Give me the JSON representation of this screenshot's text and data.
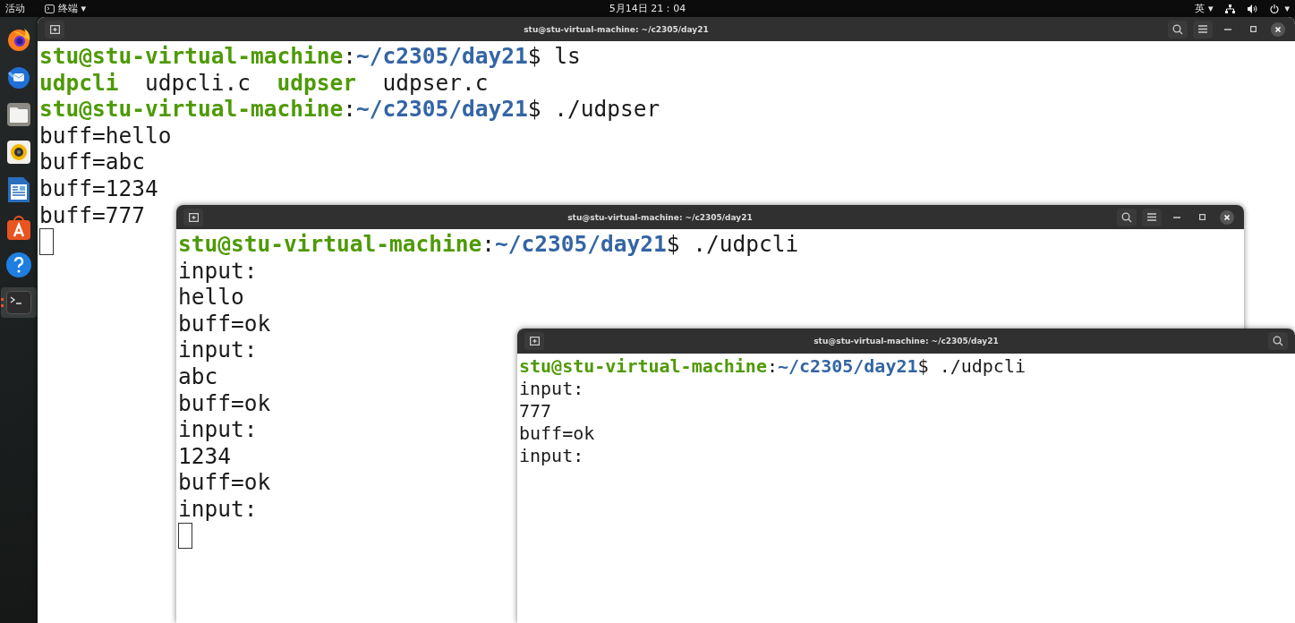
{
  "top_bar": {
    "activities": "活动",
    "app_menu": "终端",
    "app_menu_caret": "▾",
    "clock": "5月14日 21：04",
    "input_method": "英",
    "input_caret": "▾",
    "system_caret": "▾"
  },
  "dock": {
    "items": [
      {
        "kind": "browser",
        "selected": false
      },
      {
        "kind": "mail",
        "selected": false
      },
      {
        "kind": "files",
        "selected": false
      },
      {
        "kind": "music",
        "selected": false
      },
      {
        "kind": "document",
        "selected": false
      },
      {
        "kind": "store",
        "selected": false
      },
      {
        "kind": "help",
        "selected": false
      },
      {
        "kind": "terminal",
        "selected": true
      }
    ]
  },
  "windows": [
    {
      "title": "stu@stu-virtual-machine: ~/c2305/day21",
      "kind": "large",
      "controls": [
        {
          "kind": "search"
        },
        {
          "kind": "menu"
        },
        {
          "kind": "minimize"
        },
        {
          "kind": "maximize"
        },
        {
          "kind": "close"
        }
      ],
      "cursor": true,
      "lines": [
        [
          {
            "kind": "user",
            "text": "stu@stu-virtual-machine"
          },
          {
            "kind": "plain",
            "text": ":"
          },
          {
            "kind": "path",
            "text": "~/c2305/day21"
          },
          {
            "kind": "plain",
            "text": "$ ls"
          }
        ],
        [
          {
            "kind": "exec",
            "text": "udpcli"
          },
          {
            "kind": "plain",
            "text": "  udpcli.c  "
          },
          {
            "kind": "exec",
            "text": "udpser"
          },
          {
            "kind": "plain",
            "text": "  udpser.c"
          }
        ],
        [
          {
            "kind": "user",
            "text": "stu@stu-virtual-machine"
          },
          {
            "kind": "plain",
            "text": ":"
          },
          {
            "kind": "path",
            "text": "~/c2305/day21"
          },
          {
            "kind": "plain",
            "text": "$ ./udpser"
          }
        ],
        [
          {
            "kind": "plain",
            "text": "buff=hello"
          }
        ],
        [
          {
            "kind": "plain",
            "text": "buff=abc"
          }
        ],
        [
          {
            "kind": "plain",
            "text": "buff=1234"
          }
        ],
        [
          {
            "kind": "plain",
            "text": "buff=777"
          }
        ]
      ]
    },
    {
      "kind": "large",
      "controls": [
        {
          "kind": "search"
        },
        {
          "kind": "menu"
        },
        {
          "kind": "minimize"
        },
        {
          "kind": "maximize"
        },
        {
          "kind": "close"
        }
      ],
      "title": "stu@stu-virtual-machine: ~/c2305/day21",
      "cursor": true,
      "lines": [
        [
          {
            "kind": "user",
            "text": "stu@stu-virtual-machine"
          },
          {
            "kind": "plain",
            "text": ":"
          },
          {
            "kind": "path",
            "text": "~/c2305/day21"
          },
          {
            "kind": "plain",
            "text": "$ ./udpcli"
          }
        ],
        [
          {
            "kind": "plain",
            "text": "input:"
          }
        ],
        [
          {
            "kind": "plain",
            "text": "hello"
          }
        ],
        [
          {
            "kind": "plain",
            "text": "buff=ok"
          }
        ],
        [
          {
            "kind": "plain",
            "text": "input:"
          }
        ],
        [
          {
            "kind": "plain",
            "text": "abc"
          }
        ],
        [
          {
            "kind": "plain",
            "text": "buff=ok"
          }
        ],
        [
          {
            "kind": "plain",
            "text": "input:"
          }
        ],
        [
          {
            "kind": "plain",
            "text": "1234"
          }
        ],
        [
          {
            "kind": "plain",
            "text": "buff=ok"
          }
        ],
        [
          {
            "kind": "plain",
            "text": "input:"
          }
        ]
      ]
    },
    {
      "kind": "small",
      "controls": [
        {
          "kind": "search"
        }
      ],
      "title": "stu@stu-virtual-machine: ~/c2305/day21",
      "cursor": false,
      "lines": [
        [
          {
            "kind": "user",
            "text": "stu@stu-virtual-machine"
          },
          {
            "kind": "plain",
            "text": ":"
          },
          {
            "kind": "path",
            "text": "~/c2305/day21"
          },
          {
            "kind": "plain",
            "text": "$ ./udpcli"
          }
        ],
        [
          {
            "kind": "plain",
            "text": "input:"
          }
        ],
        [
          {
            "kind": "plain",
            "text": "777"
          }
        ],
        [
          {
            "kind": "plain",
            "text": "buff=ok"
          }
        ],
        [
          {
            "kind": "plain",
            "text": "input:"
          }
        ]
      ]
    }
  ]
}
